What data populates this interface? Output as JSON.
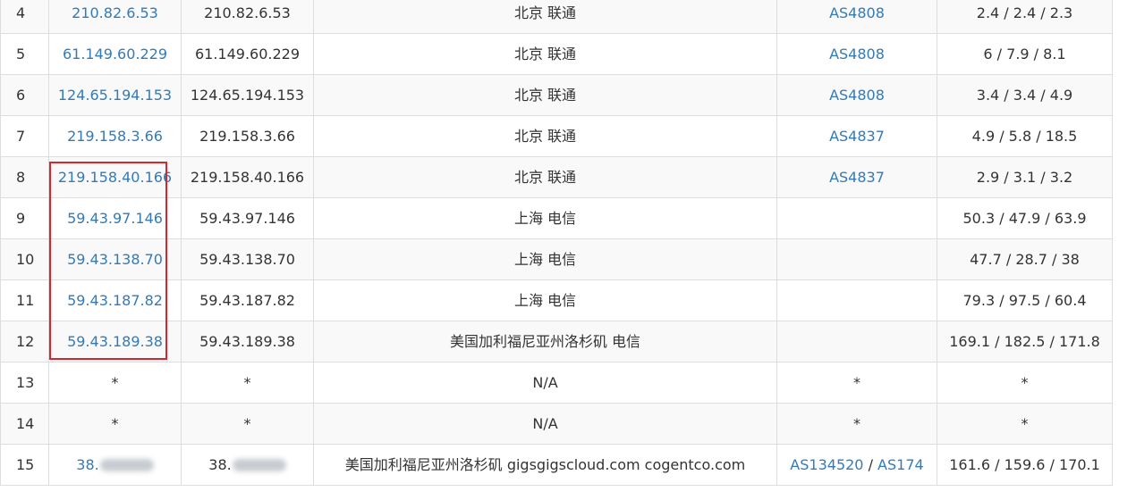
{
  "rows": [
    {
      "hop": "4",
      "ip": "210.82.6.53",
      "host": "210.82.6.53",
      "location": "北京 联通",
      "as": [
        "AS4808"
      ],
      "time": "2.4 / 2.4 / 2.3"
    },
    {
      "hop": "5",
      "ip": "61.149.60.229",
      "host": "61.149.60.229",
      "location": "北京 联通",
      "as": [
        "AS4808"
      ],
      "time": "6 / 7.9 / 8.1"
    },
    {
      "hop": "6",
      "ip": "124.65.194.153",
      "host": "124.65.194.153",
      "location": "北京 联通",
      "as": [
        "AS4808"
      ],
      "time": "3.4 / 3.4 / 4.9"
    },
    {
      "hop": "7",
      "ip": "219.158.3.66",
      "host": "219.158.3.66",
      "location": "北京 联通",
      "as": [
        "AS4837"
      ],
      "time": "4.9 / 5.8 / 18.5"
    },
    {
      "hop": "8",
      "ip": "219.158.40.166",
      "host": "219.158.40.166",
      "location": "北京 联通",
      "as": [
        "AS4837"
      ],
      "time": "2.9 / 3.1 / 3.2"
    },
    {
      "hop": "9",
      "ip": "59.43.97.146",
      "host": "59.43.97.146",
      "location": "上海 电信",
      "as": [],
      "time": "50.3 / 47.9 / 63.9"
    },
    {
      "hop": "10",
      "ip": "59.43.138.70",
      "host": "59.43.138.70",
      "location": "上海 电信",
      "as": [],
      "time": "47.7 / 28.7 / 38"
    },
    {
      "hop": "11",
      "ip": "59.43.187.82",
      "host": "59.43.187.82",
      "location": "上海 电信",
      "as": [],
      "time": "79.3 / 97.5 / 60.4"
    },
    {
      "hop": "12",
      "ip": "59.43.189.38",
      "host": "59.43.189.38",
      "location": "美国加利福尼亚州洛杉矶 电信",
      "as": [],
      "time": "169.1 / 182.5 / 171.8"
    },
    {
      "hop": "13",
      "ip": "*",
      "host": "*",
      "location": "N/A",
      "as_text": "*",
      "time": "*"
    },
    {
      "hop": "14",
      "ip": "*",
      "host": "*",
      "location": "N/A",
      "as_text": "*",
      "time": "*"
    },
    {
      "hop": "15",
      "ip": "38.",
      "host": "38.",
      "ip_obscured": true,
      "location": "美国加利福尼亚州洛杉矶 gigsgigscloud.com cogentco.com",
      "as": [
        "AS134520",
        "AS174"
      ],
      "time": "161.6 / 159.6 / 170.1"
    }
  ],
  "as_separator": " / ",
  "colors": {
    "link": "#337ab7",
    "highlight": "#d9262c",
    "border": "#dddddd",
    "stripe": "#f9f9f9"
  }
}
